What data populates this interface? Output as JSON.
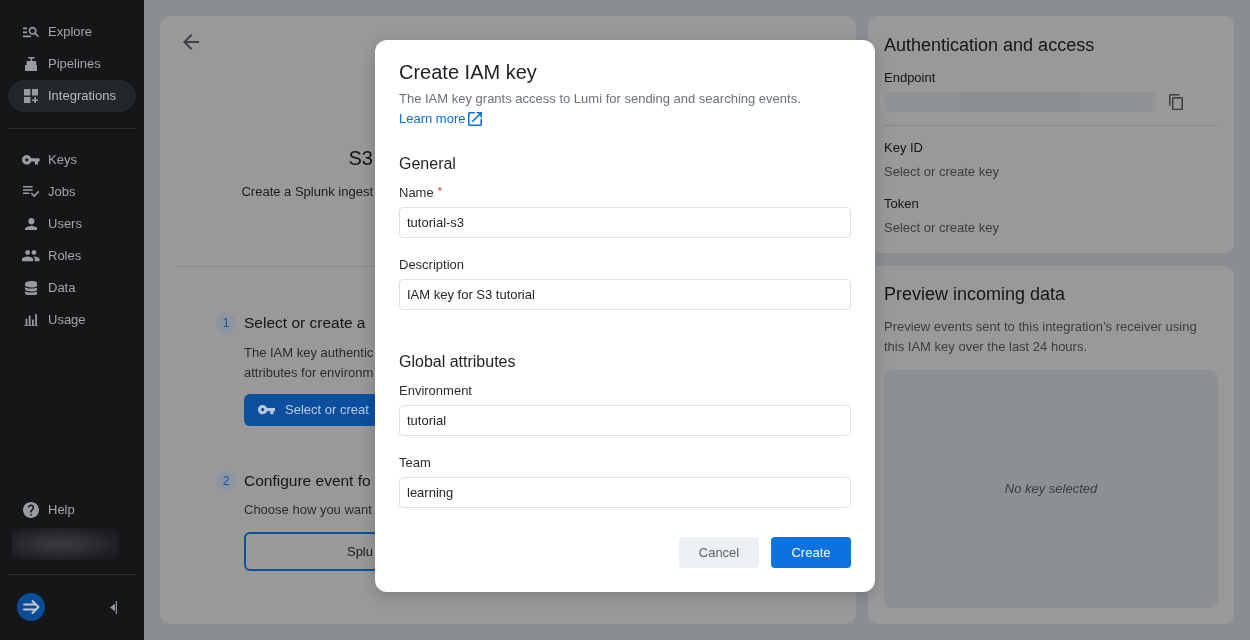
{
  "sidebar": {
    "sections": [
      {
        "items": [
          {
            "label": "Explore",
            "selected": false
          },
          {
            "label": "Pipelines",
            "selected": false
          },
          {
            "label": "Integrations",
            "selected": true
          }
        ]
      },
      {
        "items": [
          {
            "label": "Keys",
            "selected": false
          },
          {
            "label": "Jobs",
            "selected": false
          },
          {
            "label": "Users",
            "selected": false
          },
          {
            "label": "Roles",
            "selected": false
          },
          {
            "label": "Data",
            "selected": false
          },
          {
            "label": "Usage",
            "selected": false
          }
        ]
      }
    ],
    "help": {
      "label": "Help"
    }
  },
  "main_panel": {
    "title": "S3",
    "subtitle": "Create a Splunk ingest",
    "steps": [
      {
        "number": "1",
        "title": "Select or create a",
        "description": "The IAM key authentic\nattributes for environm",
        "button": {
          "label": "Select or creat",
          "kind": "primary"
        }
      },
      {
        "number": "2",
        "title": "Configure event fo",
        "description": "Choose how you want",
        "button": {
          "label": "Splu",
          "kind": "outline"
        }
      }
    ]
  },
  "auth_card": {
    "title": "Authentication and access",
    "endpoint_label": "Endpoint",
    "fields": [
      {
        "label": "Key ID",
        "value": "Select or create key"
      },
      {
        "label": "Token",
        "value": "Select or create key"
      }
    ]
  },
  "preview_card": {
    "title": "Preview incoming data",
    "description": "Preview events sent to this integration’s receiver using this IAM key over the last 24 hours.",
    "empty_text": "No key selected"
  },
  "modal": {
    "title": "Create IAM key",
    "description": "The IAM key grants access to Lumi for sending and searching events.",
    "link": "Learn more",
    "sections": [
      {
        "title": "General",
        "fields": [
          {
            "label": "Name",
            "required_mark": "*",
            "value": "tutorial-s3"
          },
          {
            "label": "Description",
            "value": "IAM key for S3 tutorial"
          }
        ]
      },
      {
        "title": "Global attributes",
        "fields": [
          {
            "label": "Environment",
            "value": "tutorial"
          },
          {
            "label": "Team",
            "value": "learning"
          }
        ]
      }
    ],
    "buttons": [
      {
        "label": "Cancel",
        "kind": "secondary"
      },
      {
        "label": "Create",
        "kind": "primary"
      }
    ]
  }
}
